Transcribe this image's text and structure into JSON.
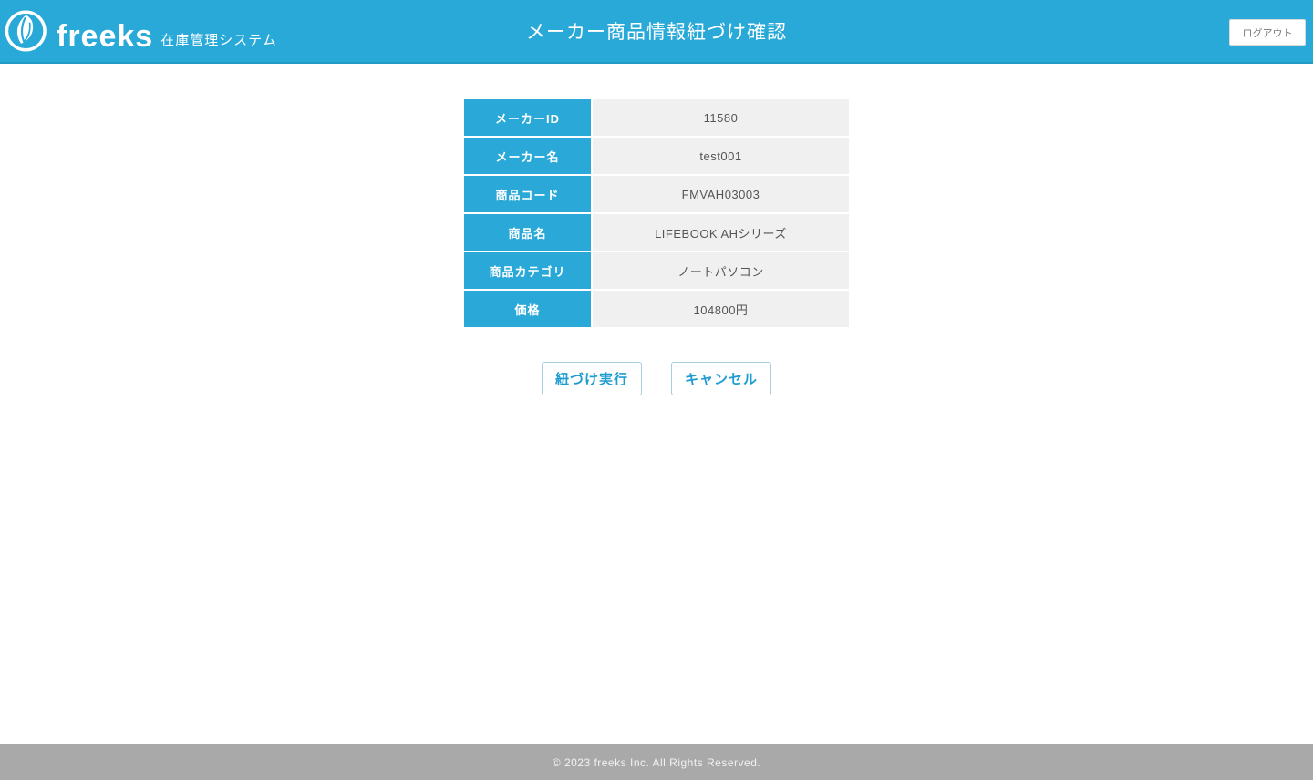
{
  "header": {
    "logo_text": "freeks",
    "logo_subtitle": "在庫管理システム",
    "title": "メーカー商品情報紐づけ確認",
    "logout_label": "ログアウト"
  },
  "table": {
    "rows": [
      {
        "label": "メーカーID",
        "value": "11580"
      },
      {
        "label": "メーカー名",
        "value": "test001"
      },
      {
        "label": "商品コード",
        "value": "FMVAH03003"
      },
      {
        "label": "商品名",
        "value": "LIFEBOOK AHシリーズ"
      },
      {
        "label": "商品カテゴリ",
        "value": "ノートパソコン"
      },
      {
        "label": "価格",
        "value": "104800円"
      }
    ]
  },
  "actions": {
    "execute_label": "紐づけ実行",
    "cancel_label": "キャンセル"
  },
  "footer": {
    "copyright": "© 2023 freeks Inc. All Rights Reserved."
  },
  "colors": {
    "brand_blue": "#29a9d8",
    "value_cell_bg": "#f0f0f0",
    "footer_gray": "#a9a9a9",
    "button_text_blue": "#1e9cd1"
  },
  "icons": {
    "logo_icon": "freeks-leaf-logo"
  }
}
